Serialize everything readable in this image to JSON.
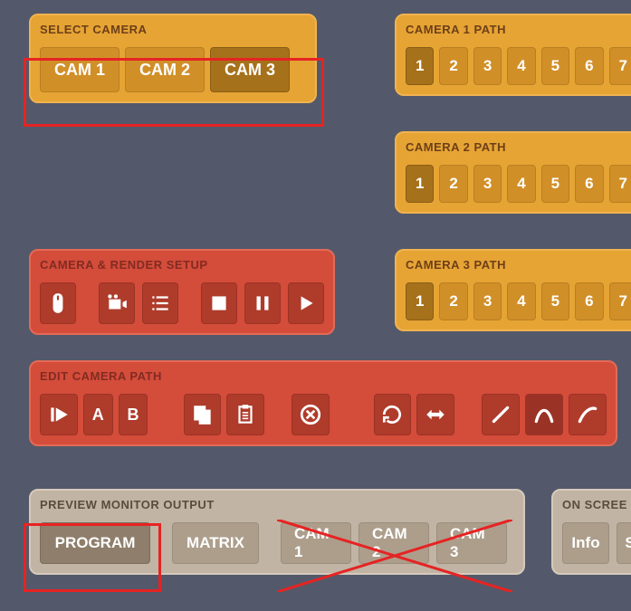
{
  "select_camera": {
    "title": "SELECT CAMERA",
    "buttons": [
      {
        "label": "CAM 1",
        "selected": false
      },
      {
        "label": "CAM 2",
        "selected": false
      },
      {
        "label": "CAM 3",
        "selected": true
      }
    ]
  },
  "camera_paths": [
    {
      "title": "CAMERA 1 PATH",
      "buttons": [
        "1",
        "2",
        "3",
        "4",
        "5",
        "6",
        "7"
      ],
      "selected_index": 0
    },
    {
      "title": "CAMERA 2 PATH",
      "buttons": [
        "1",
        "2",
        "3",
        "4",
        "5",
        "6",
        "7"
      ],
      "selected_index": 0
    },
    {
      "title": "CAMERA 3 PATH",
      "buttons": [
        "1",
        "2",
        "3",
        "4",
        "5",
        "6",
        "7"
      ],
      "selected_index": 0
    }
  ],
  "render_setup": {
    "title": "CAMERA & RENDER SETUP"
  },
  "edit_path": {
    "title": "EDIT CAMERA PATH",
    "a_label": "A",
    "b_label": "B"
  },
  "preview": {
    "title": "PREVIEW MONITOR OUTPUT",
    "buttons": [
      {
        "label": "PROGRAM",
        "selected": true
      },
      {
        "label": "MATRIX",
        "selected": false
      },
      {
        "label": "CAM 1",
        "selected": false
      },
      {
        "label": "CAM 2",
        "selected": false
      },
      {
        "label": "CAM 3",
        "selected": false
      }
    ]
  },
  "on_screen": {
    "title": "ON SCREE",
    "buttons": [
      "Info",
      "S"
    ]
  }
}
